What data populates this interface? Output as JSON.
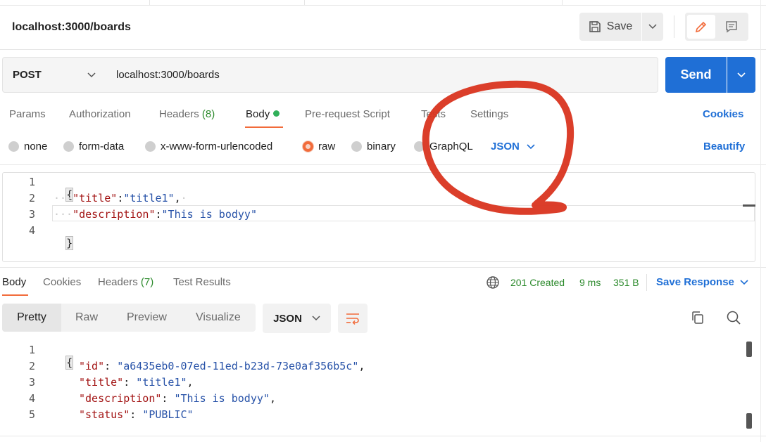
{
  "request": {
    "title": "localhost:3000/boards",
    "save_label": "Save",
    "method": "POST",
    "url": "localhost:3000/boards",
    "send_label": "Send"
  },
  "request_tabs": [
    {
      "label": "Params"
    },
    {
      "label": "Authorization"
    },
    {
      "label": "Headers",
      "count": "(8)"
    },
    {
      "label": "Body"
    },
    {
      "label": "Pre-request Script"
    },
    {
      "label": "Tests"
    },
    {
      "label": "Settings"
    }
  ],
  "cookies_label": "Cookies",
  "body_types": [
    {
      "label": "none",
      "selected": false
    },
    {
      "label": "form-data",
      "selected": false
    },
    {
      "label": "x-www-form-urlencoded",
      "selected": false
    },
    {
      "label": "raw",
      "selected": true
    },
    {
      "label": "binary",
      "selected": false
    },
    {
      "label": "GraphQL",
      "selected": false
    }
  ],
  "body_format": "JSON",
  "beautify_label": "Beautify",
  "request_body": {
    "line_numbers": [
      "1",
      "2",
      "3",
      "4"
    ],
    "open_brace": "{",
    "close_brace": "}",
    "title_key": "\"title\"",
    "title_value": "\"title1\"",
    "description_key": "\"description\"",
    "description_value": "\"This is bodyy\""
  },
  "response_tabs": [
    {
      "label": "Body"
    },
    {
      "label": "Cookies"
    },
    {
      "label": "Headers",
      "count": "(7)"
    },
    {
      "label": "Test Results"
    }
  ],
  "response_meta": {
    "status": "201 Created",
    "time": "9 ms",
    "size": "351 B",
    "save_response_label": "Save Response"
  },
  "view_modes": [
    "Pretty",
    "Raw",
    "Preview",
    "Visualize"
  ],
  "response_format": "JSON",
  "response_body": {
    "line_numbers": [
      "1",
      "2",
      "3",
      "4",
      "5"
    ],
    "open_brace": "{",
    "id_key": "\"id\"",
    "id_value": "\"a6435eb0-07ed-11ed-b23d-73e0af356b5c\"",
    "title_key": "\"title\"",
    "title_value": "\"title1\"",
    "description_key": "\"description\"",
    "description_value": "\"This is bodyy\"",
    "status_key": "\"status\"",
    "status_value": "\"PUBLIC\""
  },
  "colors": {
    "accent": "#1f6fd6",
    "active_tab": "#f26b3a",
    "success": "#2c8a2c",
    "annotation": "#d9341f"
  }
}
